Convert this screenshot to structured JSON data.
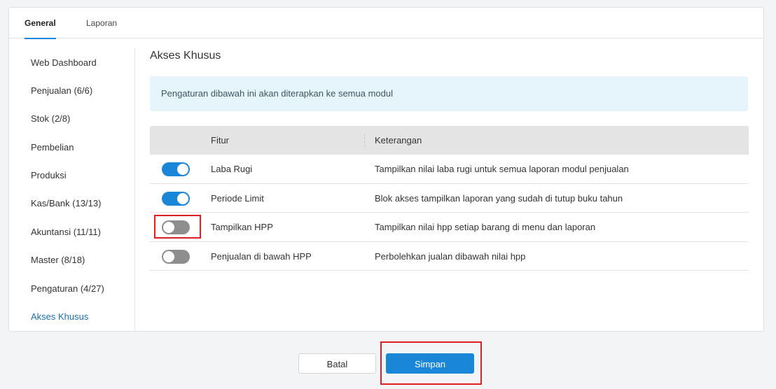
{
  "tabs": [
    {
      "label": "General",
      "active": true
    },
    {
      "label": "Laporan",
      "active": false
    }
  ],
  "sidebar": {
    "items": [
      {
        "label": "Web Dashboard"
      },
      {
        "label": "Penjualan (6/6)"
      },
      {
        "label": "Stok (2/8)"
      },
      {
        "label": "Pembelian"
      },
      {
        "label": "Produksi"
      },
      {
        "label": "Kas/Bank (13/13)"
      },
      {
        "label": "Akuntansi (11/11)"
      },
      {
        "label": "Master (8/18)"
      },
      {
        "label": "Pengaturan (4/27)"
      },
      {
        "label": "Akses Khusus",
        "active": true
      }
    ]
  },
  "section": {
    "title": "Akses Khusus",
    "info": "Pengaturan dibawah ini akan diterapkan ke semua modul"
  },
  "table": {
    "headers": {
      "feature": "Fitur",
      "description": "Keterangan"
    },
    "rows": [
      {
        "feature": "Laba Rugi",
        "description": "Tampilkan nilai laba rugi untuk semua laporan modul penjualan",
        "enabled": true
      },
      {
        "feature": "Periode Limit",
        "description": "Blok akses tampilkan laporan yang sudah di tutup buku tahun",
        "enabled": true
      },
      {
        "feature": "Tampilkan HPP",
        "description": "Tampilkan nilai hpp setiap barang di menu dan laporan",
        "enabled": false
      },
      {
        "feature": "Penjualan di bawah HPP",
        "description": "Perbolehkan jualan dibawah nilai hpp",
        "enabled": false
      }
    ]
  },
  "buttons": {
    "cancel": "Batal",
    "save": "Simpan"
  },
  "colors": {
    "accent": "#1a86d8",
    "highlight": "#e02020",
    "info_bg": "#e6f5fc"
  }
}
